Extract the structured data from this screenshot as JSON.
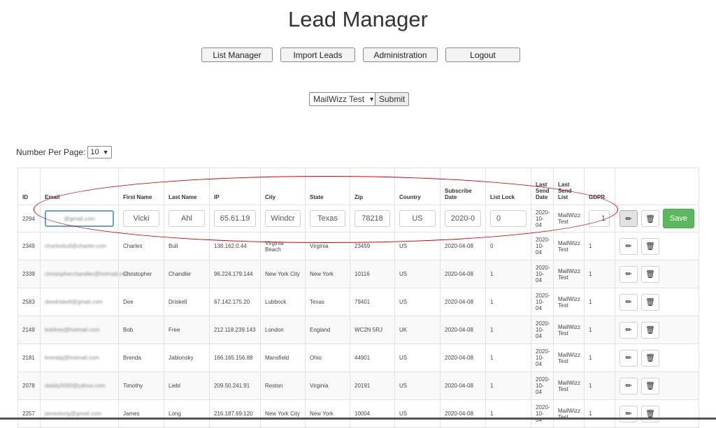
{
  "app": {
    "title": "Lead Manager"
  },
  "nav": {
    "list_manager": "List Manager",
    "import_leads": "Import Leads",
    "administration": "Administration",
    "logout": "Logout"
  },
  "list_selector": {
    "value": "MailWizz Test",
    "submit": "Submit"
  },
  "per_page": {
    "label": "Number Per Page:",
    "value": "10"
  },
  "table": {
    "headers": {
      "id": "ID",
      "email": "Email",
      "first_name": "First Name",
      "last_name": "Last Name",
      "ip": "IP",
      "city": "City",
      "state": "State",
      "zip": "Zip",
      "country": "Country",
      "subscribe_date": "Subscribe Date",
      "list_lock": "List Lock",
      "last_send_date": "Last Send Date",
      "last_send_list": "Last Send List",
      "gdpr": "GDPR"
    },
    "edit_row": {
      "id": "2294",
      "email": "@gmail.com",
      "first_name": "Vicki",
      "last_name": "Ahl",
      "ip": "65.61.19",
      "city": "Windcr",
      "state": "Texas",
      "zip": "78218",
      "country": "US",
      "subscribe_date": "2020-0",
      "list_lock": "0",
      "last_send_date": "2020-10-04",
      "last_send_list": "MailWizz Test",
      "gdpr": "1",
      "save": "Save"
    },
    "rows": [
      {
        "id": "2349",
        "email": "charlesbull@charter.com",
        "first_name": "Charles",
        "last_name": "Bull",
        "ip": "138.162.0.44",
        "city": "Virginia Beach",
        "state": "Virginia",
        "zip": "23459",
        "country": "US",
        "subscribe_date": "2020-04-08",
        "list_lock": "0",
        "last_send_date": "2020-10-04",
        "last_send_list": "MailWizz Test",
        "gdpr": "1"
      },
      {
        "id": "2339",
        "email": "christopherchandler@hotmail.com",
        "first_name": "Christopher",
        "last_name": "Chandler",
        "ip": "96.224.179.144",
        "city": "New York City",
        "state": "New York",
        "zip": "10116",
        "country": "US",
        "subscribe_date": "2020-04-08",
        "list_lock": "1",
        "last_send_date": "2020-10-04",
        "last_send_list": "MailWizz Test",
        "gdpr": "1"
      },
      {
        "id": "2583",
        "email": "deedriskell@gmail.com",
        "first_name": "Dee",
        "last_name": "Driskell",
        "ip": "67.142.175.20",
        "city": "Lubbock",
        "state": "Texas",
        "zip": "79401",
        "country": "US",
        "subscribe_date": "2020-04-08",
        "list_lock": "1",
        "last_send_date": "2020-10-04",
        "last_send_list": "MailWizz Test",
        "gdpr": "1"
      },
      {
        "id": "2149",
        "email": "bobfree@hotmail.com",
        "first_name": "Bob",
        "last_name": "Free",
        "ip": "212.118.239.143",
        "city": "London",
        "state": "England",
        "zip": "WC2N 5RJ",
        "country": "UK",
        "subscribe_date": "2020-04-08",
        "list_lock": "1",
        "last_send_date": "2020-10-04",
        "last_send_list": "MailWizz Test",
        "gdpr": "1"
      },
      {
        "id": "2181",
        "email": "brendaj@hotmail.com",
        "first_name": "Brenda",
        "last_name": "Jablonsky",
        "ip": "166.165.156.88",
        "city": "Mansfield",
        "state": "Ohio",
        "zip": "44901",
        "country": "US",
        "subscribe_date": "2020-04-08",
        "list_lock": "1",
        "last_send_date": "2020-10-04",
        "last_send_list": "MailWizz Test",
        "gdpr": "1"
      },
      {
        "id": "2078",
        "email": "daddy0000@yahoo.com",
        "first_name": "Timothy",
        "last_name": "Liebl",
        "ip": "209.50.241.91",
        "city": "Reston",
        "state": "Virginia",
        "zip": "20191",
        "country": "US",
        "subscribe_date": "2020-04-08",
        "list_lock": "1",
        "last_send_date": "2020-10-04",
        "last_send_list": "MailWizz Test",
        "gdpr": "1"
      },
      {
        "id": "2257",
        "email": "jameslong@gmail.com",
        "first_name": "James",
        "last_name": "Long",
        "ip": "216.187.69.120",
        "city": "New York City",
        "state": "New York",
        "zip": "10004",
        "country": "US",
        "subscribe_date": "2020-04-08",
        "list_lock": "1",
        "last_send_date": "2020-10-04",
        "last_send_list": "MailWizz Test",
        "gdpr": "1"
      }
    ]
  },
  "colors": {
    "save": "#5cb85c",
    "annotation": "#d40000",
    "email_focus": "#6aa0d8"
  },
  "icons": {
    "edit": "pencil-icon",
    "delete": "trash-icon",
    "dropdown": "chevron-down-icon"
  }
}
